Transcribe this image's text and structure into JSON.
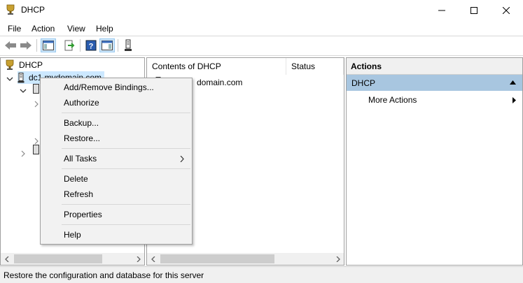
{
  "window": {
    "title": "DHCP"
  },
  "menu": [
    "File",
    "Action",
    "View",
    "Help"
  ],
  "tree": {
    "root": "DHCP",
    "server": "dc1.mydomain.com"
  },
  "center": {
    "columns": [
      "Contents of DHCP",
      "Status"
    ],
    "row_fragment": "domain.com"
  },
  "actions": {
    "title": "Actions",
    "group": "DHCP",
    "items": [
      "More Actions"
    ]
  },
  "context_menu": {
    "items": [
      "Add/Remove Bindings...",
      "Authorize",
      "Backup...",
      "Restore...",
      "All Tasks",
      "Delete",
      "Refresh",
      "Properties",
      "Help"
    ]
  },
  "status": {
    "text": "Restore the configuration and database for this server"
  },
  "colors": {
    "selection": "#a8c6e0",
    "menu_bg": "#f2f2f2"
  }
}
